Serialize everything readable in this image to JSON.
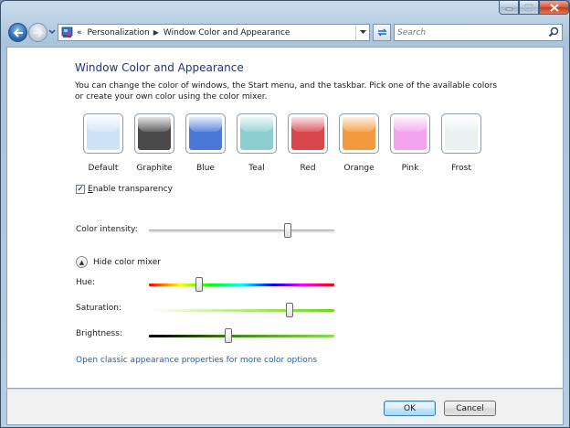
{
  "window": {
    "controls": {
      "minimize_icon": "minimize-icon",
      "maximize_icon": "maximize-icon",
      "close_icon": "close-icon"
    }
  },
  "nav": {
    "breadcrumb": [
      "Personalization",
      "Window Color and Appearance"
    ],
    "search_placeholder": "Search"
  },
  "page": {
    "title": "Window Color and Appearance",
    "description": "You can change the color of windows, the Start menu, and the taskbar. Pick one of the available colors or create your own color using the color mixer."
  },
  "swatches": [
    {
      "label": "Default",
      "color": "#cfe3f7"
    },
    {
      "label": "Graphite",
      "color": "#4a4a4a"
    },
    {
      "label": "Blue",
      "color": "#4a78d8"
    },
    {
      "label": "Teal",
      "color": "#8dcfd0"
    },
    {
      "label": "Red",
      "color": "#d9464c"
    },
    {
      "label": "Orange",
      "color": "#f49a3e"
    },
    {
      "label": "Pink",
      "color": "#f3a3ee"
    },
    {
      "label": "Frost",
      "color": "#e9f1f1"
    }
  ],
  "transparency": {
    "label": "Enable transparency",
    "checked": true
  },
  "sliders": {
    "intensity": {
      "label": "Color intensity:",
      "value": 0.75
    },
    "hue": {
      "label": "Hue:",
      "value": 0.27
    },
    "saturation": {
      "label": "Saturation:",
      "value": 0.76
    },
    "brightness": {
      "label": "Brightness:",
      "value": 0.43
    }
  },
  "mixer_toggle": {
    "label": "Hide color mixer"
  },
  "classic_link": "Open classic appearance properties for more color options",
  "buttons": {
    "ok": "OK",
    "cancel": "Cancel"
  }
}
